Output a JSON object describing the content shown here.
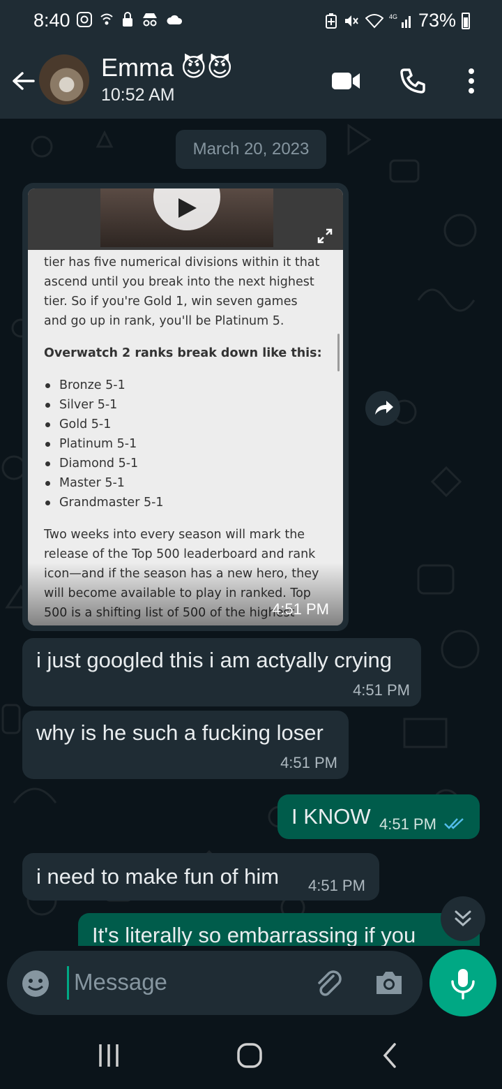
{
  "status_bar": {
    "time": "8:40",
    "battery": "73%"
  },
  "header": {
    "contact_name": "Emma 😈😈",
    "last_seen": "10:52 AM"
  },
  "chat": {
    "date_label": "March 20, 2023",
    "image_message": {
      "time": "4:51 PM",
      "article_para1": "tier has five numerical divisions within it that ascend until you break into the next highest tier. So if you're Gold 1, win seven games and go up in rank, you'll be Platinum 5.",
      "article_heading": "Overwatch 2 ranks break down like this:",
      "ranks": [
        "Bronze 5-1",
        "Silver 5-1",
        "Gold 5-1",
        "Platinum 5-1",
        "Diamond 5-1",
        "Master 5-1",
        "Grandmaster 5-1"
      ],
      "article_para2": "Two weeks into every season will mark the release of the Top 500 leaderboard and rank icon—and if the season has a new hero, they will become available to play in ranked. Top 500 is a shifting list of 500 of the highest ranked players. It doesn't require you to be in"
    },
    "messages": [
      {
        "direction": "in",
        "text": "i just googled this i am actyally crying",
        "time": "4:51 PM"
      },
      {
        "direction": "in",
        "text": "why is he such a fucking loser",
        "time": "4:51 PM"
      },
      {
        "direction": "out",
        "text": "I KNOW",
        "time": "4:51 PM",
        "read": true
      },
      {
        "direction": "in",
        "text": "i need to make fun of him",
        "time": "4:51 PM"
      },
      {
        "direction": "out",
        "text": "It's literally so embarrassing if you",
        "time": ""
      }
    ]
  },
  "input": {
    "placeholder": "Message"
  },
  "colors": {
    "background": "#0b141a",
    "bar": "#1f2c34",
    "incoming_bubble": "#1f2c34",
    "outgoing_bubble": "#005c4b",
    "accent": "#00a884",
    "read_ticks": "#53bdeb"
  }
}
